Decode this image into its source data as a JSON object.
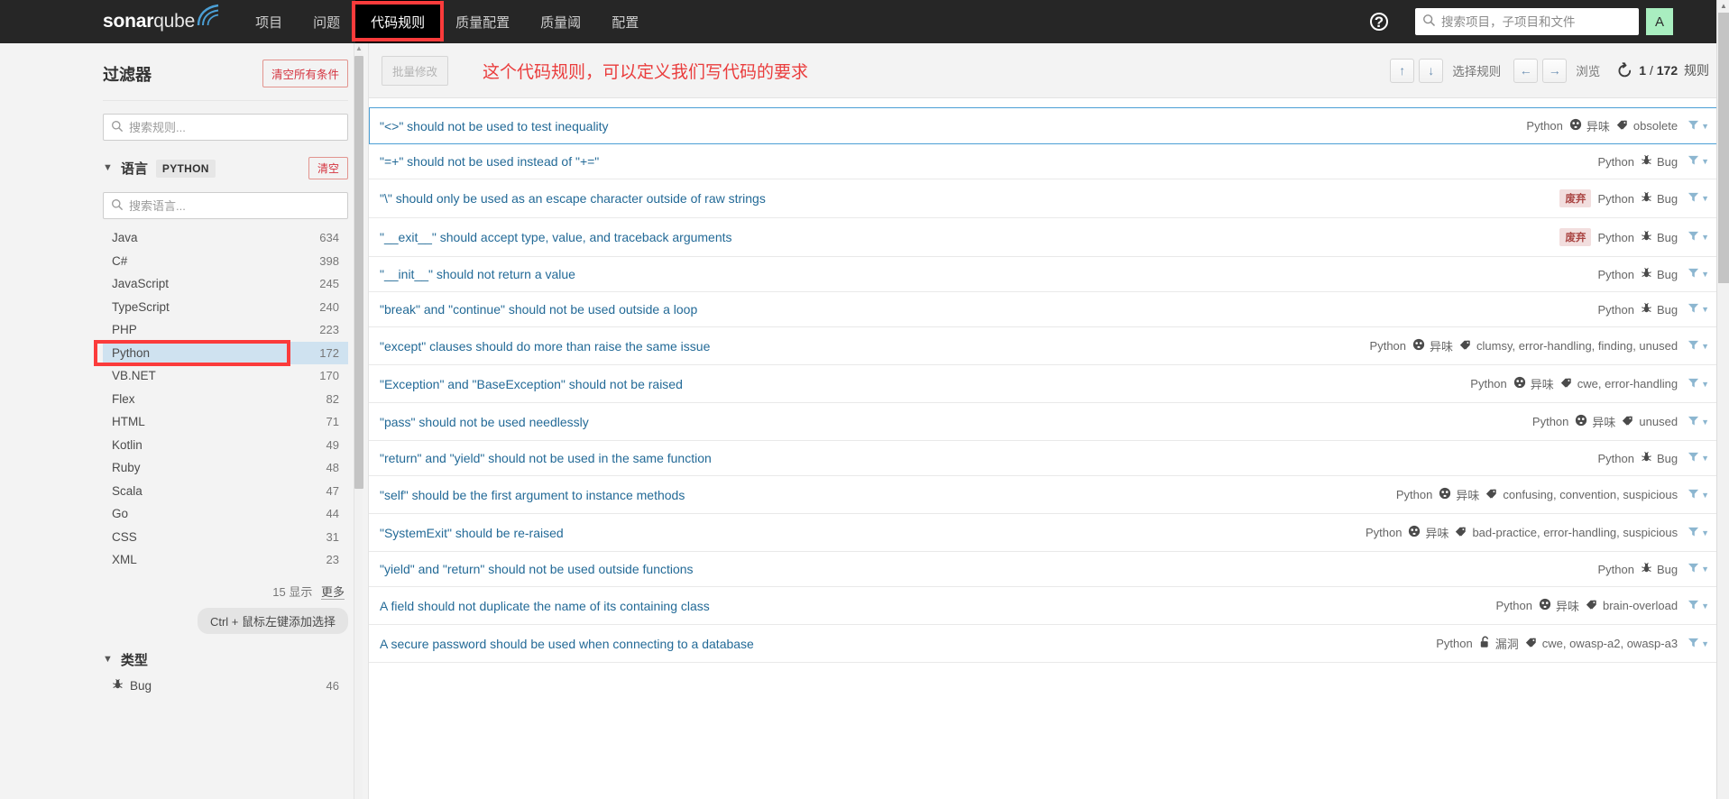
{
  "header": {
    "brand_bold": "sonar",
    "brand_light": "qube",
    "nav": [
      {
        "label": "项目",
        "active": false
      },
      {
        "label": "问题",
        "active": false
      },
      {
        "label": "代码规则",
        "active": true
      },
      {
        "label": "质量配置",
        "active": false
      },
      {
        "label": "质量阈",
        "active": false
      },
      {
        "label": "配置",
        "active": false
      }
    ],
    "help_glyph": "?",
    "search_placeholder": "搜索项目，子项目和文件",
    "search_value": "",
    "avatar_initial": "A"
  },
  "sidebar": {
    "title": "过滤器",
    "clear_all_label": "清空所有条件",
    "rule_search_placeholder": "搜索规则...",
    "rule_search_value": "",
    "language_facet": {
      "name": "语言",
      "selected_value": "PYTHON",
      "clear_label": "清空",
      "search_placeholder": "搜索语言...",
      "search_value": "",
      "items": [
        {
          "label": "Java",
          "count": "634",
          "selected": false
        },
        {
          "label": "C#",
          "count": "398",
          "selected": false
        },
        {
          "label": "JavaScript",
          "count": "245",
          "selected": false
        },
        {
          "label": "TypeScript",
          "count": "240",
          "selected": false
        },
        {
          "label": "PHP",
          "count": "223",
          "selected": false
        },
        {
          "label": "Python",
          "count": "172",
          "selected": true
        },
        {
          "label": "VB.NET",
          "count": "170",
          "selected": false
        },
        {
          "label": "Flex",
          "count": "82",
          "selected": false
        },
        {
          "label": "HTML",
          "count": "71",
          "selected": false
        },
        {
          "label": "Kotlin",
          "count": "49",
          "selected": false
        },
        {
          "label": "Ruby",
          "count": "48",
          "selected": false
        },
        {
          "label": "Scala",
          "count": "47",
          "selected": false
        },
        {
          "label": "Go",
          "count": "44",
          "selected": false
        },
        {
          "label": "CSS",
          "count": "31",
          "selected": false
        },
        {
          "label": "XML",
          "count": "23",
          "selected": false
        }
      ],
      "show_count": "15 显示",
      "show_more": "更多",
      "hint": "Ctrl + 鼠标左键添加选择"
    },
    "type_facet": {
      "name": "类型",
      "items": [
        {
          "label": "Bug",
          "count": "46"
        }
      ]
    }
  },
  "toolbar": {
    "bulk_edit_label": "批量修改",
    "annotation_note": "这个代码规则，可以定义我们写代码的要求",
    "up_glyph": "↑",
    "down_glyph": "↓",
    "select_rule_label": "选择规则",
    "prev_glyph": "←",
    "next_glyph": "→",
    "browse_label": "浏览",
    "count_current": "1",
    "count_separator": "/",
    "count_total": "172",
    "count_unit": "规则"
  },
  "rules": [
    {
      "title": "\"<>\" should not be used to test inequality",
      "deprecated": "",
      "language": "Python",
      "type": "异味",
      "type_icon": "code-smell-icon",
      "tags": "obsolete",
      "selected": true
    },
    {
      "title": "\"=+\" should not be used instead of \"+=\"",
      "deprecated": "",
      "language": "Python",
      "type": "Bug",
      "type_icon": "bug-icon",
      "tags": "",
      "selected": false
    },
    {
      "title": "\"\\\" should only be used as an escape character outside of raw strings",
      "deprecated": "废弃",
      "language": "Python",
      "type": "Bug",
      "type_icon": "bug-icon",
      "tags": "",
      "selected": false
    },
    {
      "title": "\"__exit__\" should accept type, value, and traceback arguments",
      "deprecated": "废弃",
      "language": "Python",
      "type": "Bug",
      "type_icon": "bug-icon",
      "tags": "",
      "selected": false
    },
    {
      "title": "\"__init__\" should not return a value",
      "deprecated": "",
      "language": "Python",
      "type": "Bug",
      "type_icon": "bug-icon",
      "tags": "",
      "selected": false
    },
    {
      "title": "\"break\" and \"continue\" should not be used outside a loop",
      "deprecated": "",
      "language": "Python",
      "type": "Bug",
      "type_icon": "bug-icon",
      "tags": "",
      "selected": false
    },
    {
      "title": "\"except\" clauses should do more than raise the same issue",
      "deprecated": "",
      "language": "Python",
      "type": "异味",
      "type_icon": "code-smell-icon",
      "tags": "clumsy, error-handling, finding, unused",
      "selected": false
    },
    {
      "title": "\"Exception\" and \"BaseException\" should not be raised",
      "deprecated": "",
      "language": "Python",
      "type": "异味",
      "type_icon": "code-smell-icon",
      "tags": "cwe, error-handling",
      "selected": false
    },
    {
      "title": "\"pass\" should not be used needlessly",
      "deprecated": "",
      "language": "Python",
      "type": "异味",
      "type_icon": "code-smell-icon",
      "tags": "unused",
      "selected": false
    },
    {
      "title": "\"return\" and \"yield\" should not be used in the same function",
      "deprecated": "",
      "language": "Python",
      "type": "Bug",
      "type_icon": "bug-icon",
      "tags": "",
      "selected": false
    },
    {
      "title": "\"self\" should be the first argument to instance methods",
      "deprecated": "",
      "language": "Python",
      "type": "异味",
      "type_icon": "code-smell-icon",
      "tags": "confusing, convention, suspicious",
      "selected": false
    },
    {
      "title": "\"SystemExit\" should be re-raised",
      "deprecated": "",
      "language": "Python",
      "type": "异味",
      "type_icon": "code-smell-icon",
      "tags": "bad-practice, error-handling, suspicious",
      "selected": false
    },
    {
      "title": "\"yield\" and \"return\" should not be used outside functions",
      "deprecated": "",
      "language": "Python",
      "type": "Bug",
      "type_icon": "bug-icon",
      "tags": "",
      "selected": false
    },
    {
      "title": "A field should not duplicate the name of its containing class",
      "deprecated": "",
      "language": "Python",
      "type": "异味",
      "type_icon": "code-smell-icon",
      "tags": "brain-overload",
      "selected": false
    },
    {
      "title": "A secure password should be used when connecting to a database",
      "deprecated": "",
      "language": "Python",
      "type": "漏洞",
      "type_icon": "vulnerability-icon",
      "tags": "cwe, owasp-a2, owasp-a3",
      "selected": false
    }
  ],
  "colors": {
    "accent_red": "#ea3d3d",
    "link_blue": "#236a97",
    "selected_blue": "#4b9fd5",
    "facet_selected_bg": "#cfe2f0",
    "avatar_green": "#a9eec0",
    "topnav_bg": "#262626"
  }
}
